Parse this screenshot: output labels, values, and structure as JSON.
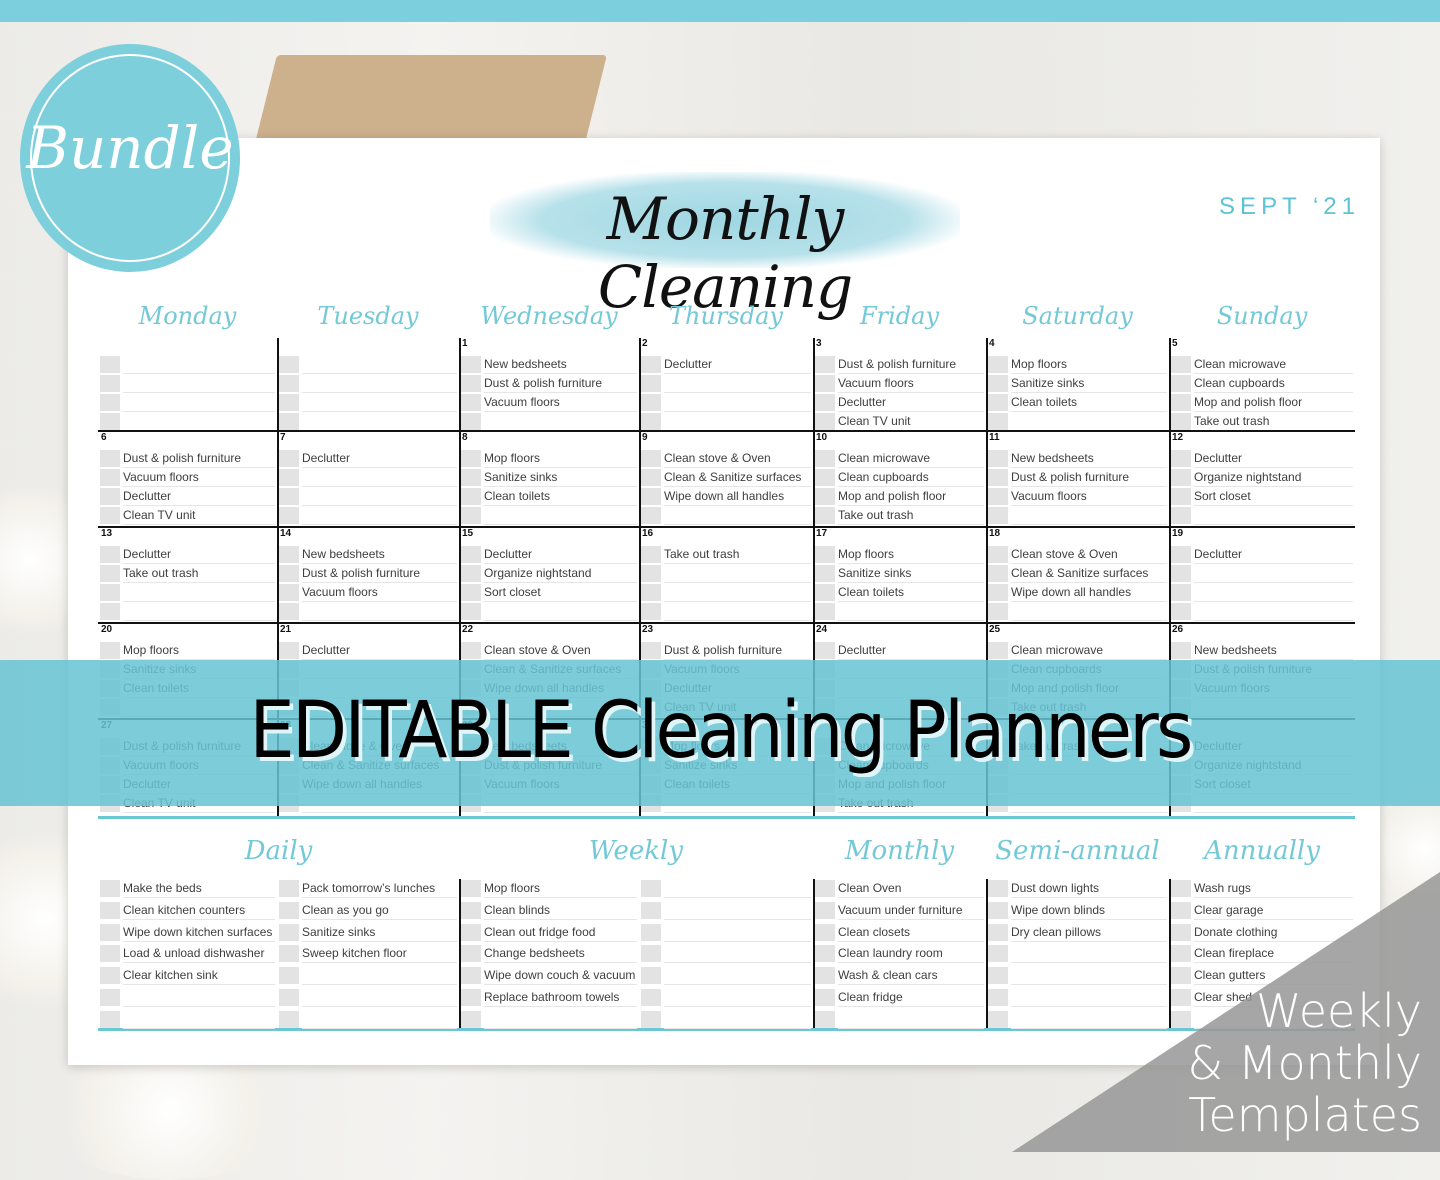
{
  "badge": {
    "label": "Bundle"
  },
  "header": {
    "title": "Monthly Cleaning",
    "month": "SEPT ‘21"
  },
  "days": [
    "Monday",
    "Tuesday",
    "Wednesday",
    "Thursday",
    "Friday",
    "Saturday",
    "Sunday"
  ],
  "weeks": [
    [
      {
        "num": "",
        "tasks": []
      },
      {
        "num": "",
        "tasks": []
      },
      {
        "num": "1",
        "tasks": [
          "New bedsheets",
          "Dust & polish furniture",
          "Vacuum floors"
        ]
      },
      {
        "num": "2",
        "tasks": [
          "Declutter"
        ]
      },
      {
        "num": "3",
        "tasks": [
          "Dust & polish furniture",
          "Vacuum floors",
          "Declutter",
          "Clean TV unit"
        ]
      },
      {
        "num": "4",
        "tasks": [
          "Mop floors",
          "Sanitize sinks",
          "Clean toilets"
        ]
      },
      {
        "num": "5",
        "tasks": [
          "Clean microwave",
          "Clean cupboards",
          "Mop and polish floor",
          "Take out trash"
        ]
      }
    ],
    [
      {
        "num": "6",
        "tasks": [
          "Dust & polish furniture",
          "Vacuum floors",
          "Declutter",
          "Clean TV unit"
        ]
      },
      {
        "num": "7",
        "tasks": [
          "Declutter"
        ]
      },
      {
        "num": "8",
        "tasks": [
          "Mop floors",
          "Sanitize sinks",
          "Clean toilets"
        ]
      },
      {
        "num": "9",
        "tasks": [
          "Clean stove & Oven",
          "Clean & Sanitize surfaces",
          "Wipe down all handles"
        ]
      },
      {
        "num": "10",
        "tasks": [
          "Clean microwave",
          "Clean cupboards",
          "Mop and polish floor",
          "Take out trash"
        ]
      },
      {
        "num": "11",
        "tasks": [
          "New bedsheets",
          "Dust & polish furniture",
          "Vacuum floors"
        ]
      },
      {
        "num": "12",
        "tasks": [
          "Declutter",
          "Organize nightstand",
          "Sort closet"
        ]
      }
    ],
    [
      {
        "num": "13",
        "tasks": [
          "Declutter",
          "Take out trash"
        ]
      },
      {
        "num": "14",
        "tasks": [
          "New bedsheets",
          "Dust & polish furniture",
          "Vacuum floors"
        ]
      },
      {
        "num": "15",
        "tasks": [
          "Declutter",
          "Organize nightstand",
          "Sort closet"
        ]
      },
      {
        "num": "16",
        "tasks": [
          "Take out trash"
        ]
      },
      {
        "num": "17",
        "tasks": [
          "Mop floors",
          "Sanitize sinks",
          "Clean toilets"
        ]
      },
      {
        "num": "18",
        "tasks": [
          "Clean stove & Oven",
          "Clean & Sanitize surfaces",
          "Wipe down all handles"
        ]
      },
      {
        "num": "19",
        "tasks": [
          "Declutter"
        ]
      }
    ],
    [
      {
        "num": "20",
        "tasks": [
          "Mop floors",
          "Sanitize sinks",
          "Clean toilets"
        ]
      },
      {
        "num": "21",
        "tasks": [
          "Declutter"
        ]
      },
      {
        "num": "22",
        "tasks": [
          "Clean stove & Oven",
          "Clean & Sanitize surfaces",
          "Wipe down all handles"
        ]
      },
      {
        "num": "23",
        "tasks": [
          "Dust & polish furniture",
          "Vacuum floors",
          "Declutter",
          "Clean TV unit"
        ]
      },
      {
        "num": "24",
        "tasks": [
          "Declutter"
        ]
      },
      {
        "num": "25",
        "tasks": [
          "Clean microwave",
          "Clean cupboards",
          "Mop and polish floor",
          "Take out trash"
        ]
      },
      {
        "num": "26",
        "tasks": [
          "New bedsheets",
          "Dust & polish furniture",
          "Vacuum floors"
        ]
      }
    ],
    [
      {
        "num": "27",
        "tasks": [
          "Dust & polish furniture",
          "Vacuum floors",
          "Declutter",
          "Clean TV unit"
        ]
      },
      {
        "num": "28",
        "tasks": [
          "Clean stove & Oven",
          "Clean & Sanitize surfaces",
          "Wipe down all handles"
        ]
      },
      {
        "num": "29",
        "tasks": [
          "New bedsheets",
          "Dust & polish furniture",
          "Vacuum floors"
        ]
      },
      {
        "num": "30",
        "tasks": [
          "Mop floors",
          "Sanitize sinks",
          "Clean toilets"
        ]
      },
      {
        "num": "",
        "tasks": [
          "Clean microwave",
          "Clean cupboards",
          "Mop and polish floor",
          "Take out trash"
        ]
      },
      {
        "num": "",
        "tasks": [
          "Take out trash"
        ]
      },
      {
        "num": "",
        "tasks": [
          "Declutter",
          "Organize nightstand",
          "Sort closet"
        ]
      }
    ]
  ],
  "lists": {
    "daily": {
      "title": "Daily",
      "col1": [
        "Make the beds",
        "Clean kitchen counters",
        "Wipe down kitchen surfaces",
        "Load & unload dishwasher",
        "Clear kitchen sink",
        "",
        ""
      ],
      "col2": [
        "Pack tomorrow’s lunches",
        "Clean as you go",
        "Sanitize sinks",
        "Sweep kitchen floor",
        "",
        "",
        ""
      ]
    },
    "weekly": {
      "title": "Weekly",
      "col1": [
        "Mop floors",
        "Clean blinds",
        "Clean out fridge food",
        "Change bedsheets",
        "Wipe down couch & vacuum",
        "Replace bathroom towels",
        ""
      ],
      "col2": [
        "",
        "",
        "",
        "",
        "",
        "",
        ""
      ]
    },
    "monthly": {
      "title": "Monthly",
      "col1": [
        "Clean Oven",
        "Vacuum under furniture",
        "Clean closets",
        "Clean laundry room",
        "Wash & clean cars",
        "Clean fridge",
        ""
      ]
    },
    "semiannual": {
      "title": "Semi-annual",
      "col1": [
        "Dust down lights",
        "Wipe down blinds",
        "Dry clean pillows",
        "",
        "",
        "",
        ""
      ]
    },
    "annually": {
      "title": "Annually",
      "col1": [
        "Wash rugs",
        "Clear garage",
        "Donate clothing",
        "Clean fireplace",
        "Clean gutters",
        "Clear shed",
        ""
      ]
    }
  },
  "banner": {
    "text": "EDITABLE Cleaning Planners"
  },
  "corner": {
    "line1": "Weekly",
    "line2": "& Monthly",
    "line3": "Templates"
  },
  "colors": {
    "accent": "#7ccfdc",
    "banner": "#68c4d4",
    "checkbox": "#e4e3e3"
  }
}
